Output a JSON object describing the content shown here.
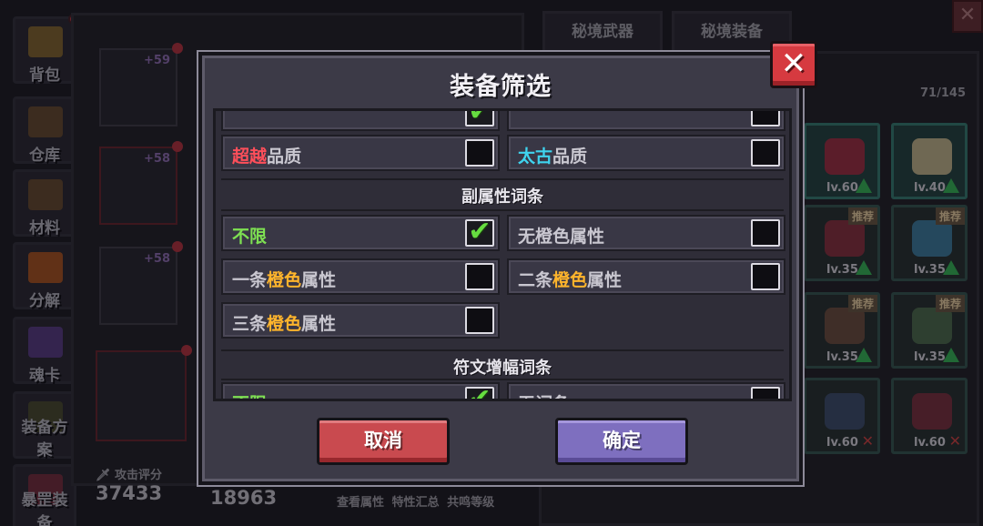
{
  "side_nav": [
    {
      "label": "背包",
      "color": "#8a6a2a"
    },
    {
      "label": "仓库",
      "color": "#6a4a2a"
    },
    {
      "label": "材料",
      "color": "#6a4a2a"
    },
    {
      "label": "分解",
      "color": "#b5541a"
    },
    {
      "label": "魂卡",
      "color": "#5a3a8a"
    },
    {
      "label": "装备方案",
      "color": "#4a4a2a"
    },
    {
      "label": "暴罡装备",
      "color": "#7a2a3a"
    }
  ],
  "character": {
    "slot_levels": [
      "+59",
      "+58",
      "+58"
    ],
    "attack_label": "攻击评分",
    "attack_value": "37433",
    "defense_value": "18963",
    "bottom_links": [
      "查看属性",
      "特性汇总",
      "共鸣等级"
    ]
  },
  "right_tabs": [
    "秘境武器",
    "秘境装备"
  ],
  "inventory": {
    "count": "71/145",
    "items": [
      {
        "lv": "lv.60",
        "recommend": false,
        "upgrade": true,
        "x": false,
        "color": "#a3243a"
      },
      {
        "lv": "lv.40",
        "recommend": false,
        "upgrade": true,
        "x": false,
        "color": "#c8b48a"
      },
      {
        "lv": "lv.35",
        "recommend": true,
        "upgrade": true,
        "x": false,
        "color": "#8a2a3a"
      },
      {
        "lv": "lv.35",
        "recommend": true,
        "upgrade": true,
        "x": false,
        "color": "#3a7aa0"
      },
      {
        "lv": "lv.35",
        "recommend": true,
        "upgrade": true,
        "x": false,
        "color": "#6a4a3a"
      },
      {
        "lv": "lv.35",
        "recommend": true,
        "upgrade": true,
        "x": false,
        "color": "#4a6a4a"
      },
      {
        "lv": "lv.60",
        "recommend": false,
        "upgrade": false,
        "x": true,
        "color": "#3a4a6a"
      },
      {
        "lv": "lv.60",
        "recommend": false,
        "upgrade": false,
        "x": true,
        "color": "#7a2a3a"
      }
    ],
    "recommend_label": "推荐"
  },
  "modal": {
    "title": "装备筛选",
    "quality_options": [
      {
        "prefix": "超越",
        "suffix": "品质",
        "prefix_color": "red",
        "checked": false
      },
      {
        "prefix": "太古",
        "suffix": "品质",
        "prefix_color": "cyan",
        "checked": false
      }
    ],
    "sub_attr_section": "副属性词条",
    "sub_attr_options": [
      {
        "prefix": "不限",
        "suffix": "",
        "mid": "",
        "prefix_color": "green",
        "checked": true
      },
      {
        "prefix": "无橙色属性",
        "suffix": "",
        "mid": "",
        "prefix_color": "plain",
        "checked": false
      },
      {
        "prefix": "一条",
        "mid": "橙色",
        "suffix": "属性",
        "prefix_color": "plain",
        "checked": false
      },
      {
        "prefix": "二条",
        "mid": "橙色",
        "suffix": "属性",
        "prefix_color": "plain",
        "checked": false
      },
      {
        "prefix": "三条",
        "mid": "橙色",
        "suffix": "属性",
        "prefix_color": "plain",
        "checked": false
      }
    ],
    "rune_section": "符文增幅词条",
    "rune_options": [
      {
        "label": "不限",
        "checked": true
      },
      {
        "label": "无词条",
        "checked": false
      }
    ],
    "cancel_label": "取消",
    "confirm_label": "确定"
  }
}
